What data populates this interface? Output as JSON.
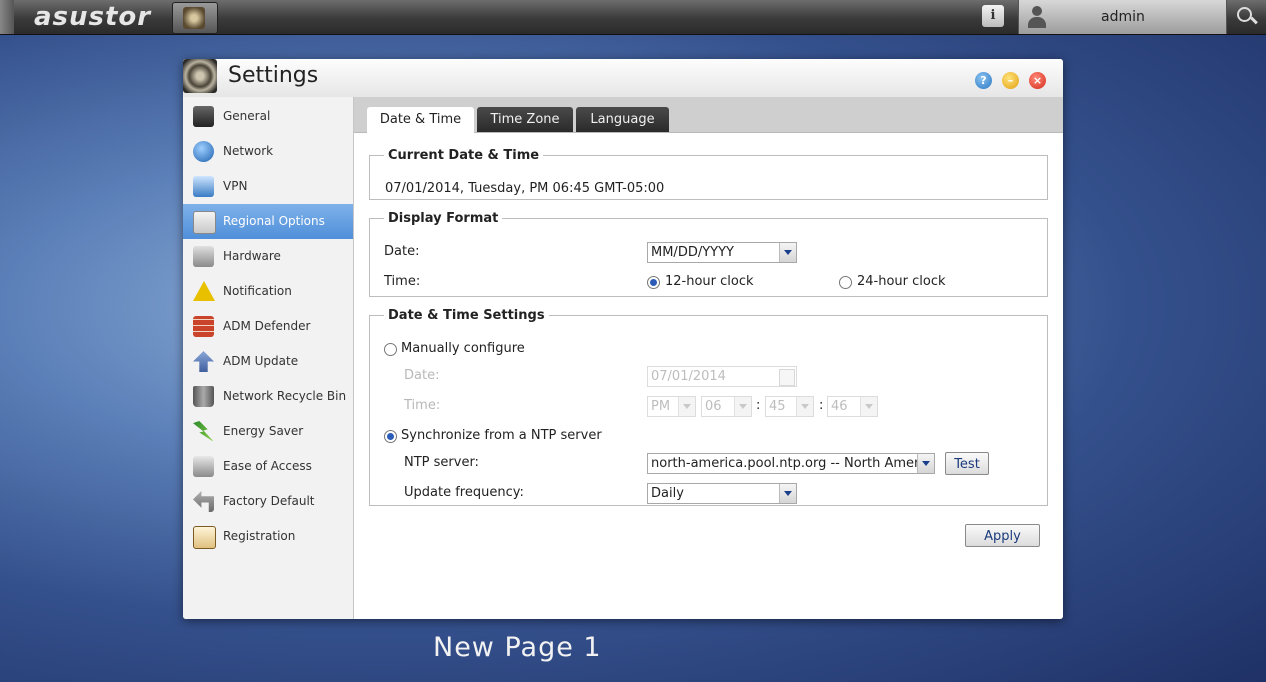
{
  "topbar": {
    "logo": "asustor",
    "user": "admin",
    "info_glyph": "i"
  },
  "window": {
    "title": "Settings",
    "controls": {
      "help": "?",
      "minimize": "–",
      "close": "×"
    }
  },
  "sidebar": {
    "items": [
      {
        "label": "General",
        "icon": "general-icon"
      },
      {
        "label": "Network",
        "icon": "network-icon"
      },
      {
        "label": "VPN",
        "icon": "vpn-icon"
      },
      {
        "label": "Regional Options",
        "icon": "regional-options-icon",
        "active": true
      },
      {
        "label": "Hardware",
        "icon": "hardware-icon"
      },
      {
        "label": "Notification",
        "icon": "warning-icon"
      },
      {
        "label": "ADM Defender",
        "icon": "firewall-icon"
      },
      {
        "label": "ADM Update",
        "icon": "up-arrow-icon"
      },
      {
        "label": "Network Recycle Bin",
        "icon": "trash-icon"
      },
      {
        "label": "Energy Saver",
        "icon": "lightning-icon"
      },
      {
        "label": "Ease of Access",
        "icon": "printer-icon"
      },
      {
        "label": "Factory Default",
        "icon": "undo-icon"
      },
      {
        "label": "Registration",
        "icon": "clipboard-icon"
      }
    ]
  },
  "tabs": [
    "Date & Time",
    "Time Zone",
    "Language"
  ],
  "current": {
    "legend": "Current Date & Time",
    "value": "07/01/2014, Tuesday, PM 06:45 GMT-05:00"
  },
  "display_format": {
    "legend": "Display Format",
    "date_label": "Date:",
    "date_value": "MM/DD/YYYY",
    "time_label": "Time:",
    "option_12": "12-hour clock",
    "option_24": "24-hour clock",
    "selected": "12-hour clock"
  },
  "settings": {
    "legend": "Date & Time Settings",
    "manual_label": "Manually configure",
    "date_label": "Date:",
    "date_value": "07/01/2014",
    "time_label": "Time:",
    "ampm": "PM",
    "hour": "06",
    "minute": "45",
    "second": "46",
    "colon": ":",
    "ntp_label": "Synchronize from a NTP server",
    "selected": "Synchronize from a NTP server",
    "server_label": "NTP server:",
    "server_value": "north-america.pool.ntp.org -- North America",
    "test_label": "Test",
    "freq_label": "Update frequency:",
    "freq_value": "Daily"
  },
  "apply_label": "Apply",
  "footer": "New Page 1",
  "colors": {
    "accent": "#4f8fd9",
    "tab_inactive": "#2a2a2a"
  }
}
